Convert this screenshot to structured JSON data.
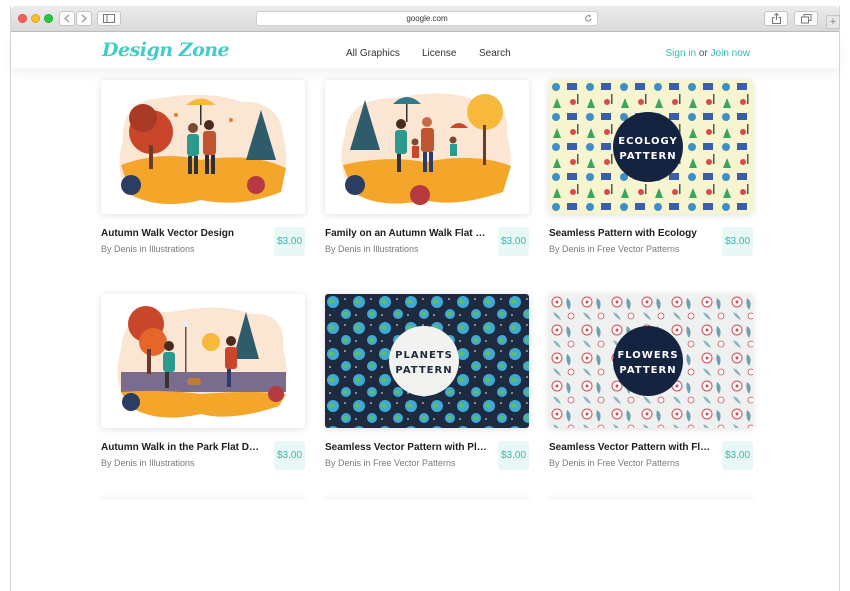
{
  "browser": {
    "url": "google.com"
  },
  "site": {
    "logo": "Design Zone",
    "nav": [
      "All Graphics",
      "License",
      "Search"
    ],
    "auth": {
      "sign_in": "Sign in",
      "or": "or",
      "join": "Join now"
    }
  },
  "cards": [
    {
      "title": "Autumn Walk Vector Design",
      "author": "By Denis in Illustrations",
      "price": "$3.00"
    },
    {
      "title": "Family on an Autumn Walk Flat Design",
      "author": "By Denis in Illustrations",
      "price": "$3.00"
    },
    {
      "title": "Seamless Pattern with Ecology",
      "author": "By Denis in Free Vector Patterns",
      "price": "$3.00",
      "badge": [
        "ECOLOGY",
        "PATTERN"
      ]
    },
    {
      "title": "Autumn Walk in the Park Flat Design",
      "author": "By Denis in Illustrations",
      "price": "$3.00"
    },
    {
      "title": "Seamless Vector Pattern with Planets",
      "author": "By Denis in Free Vector Patterns",
      "price": "$3.00",
      "badge": [
        "PLANETS",
        "PATTERN"
      ]
    },
    {
      "title": "Seamless Vector Pattern with Flowers",
      "author": "By Denis in Free Vector Patterns",
      "price": "$3.00",
      "badge": [
        "FLOWERS",
        "PATTERN"
      ]
    }
  ],
  "colors": {
    "accent": "#3fcfc4",
    "price_bg": "#e9f8f6",
    "badge_dark": "#14233f"
  }
}
